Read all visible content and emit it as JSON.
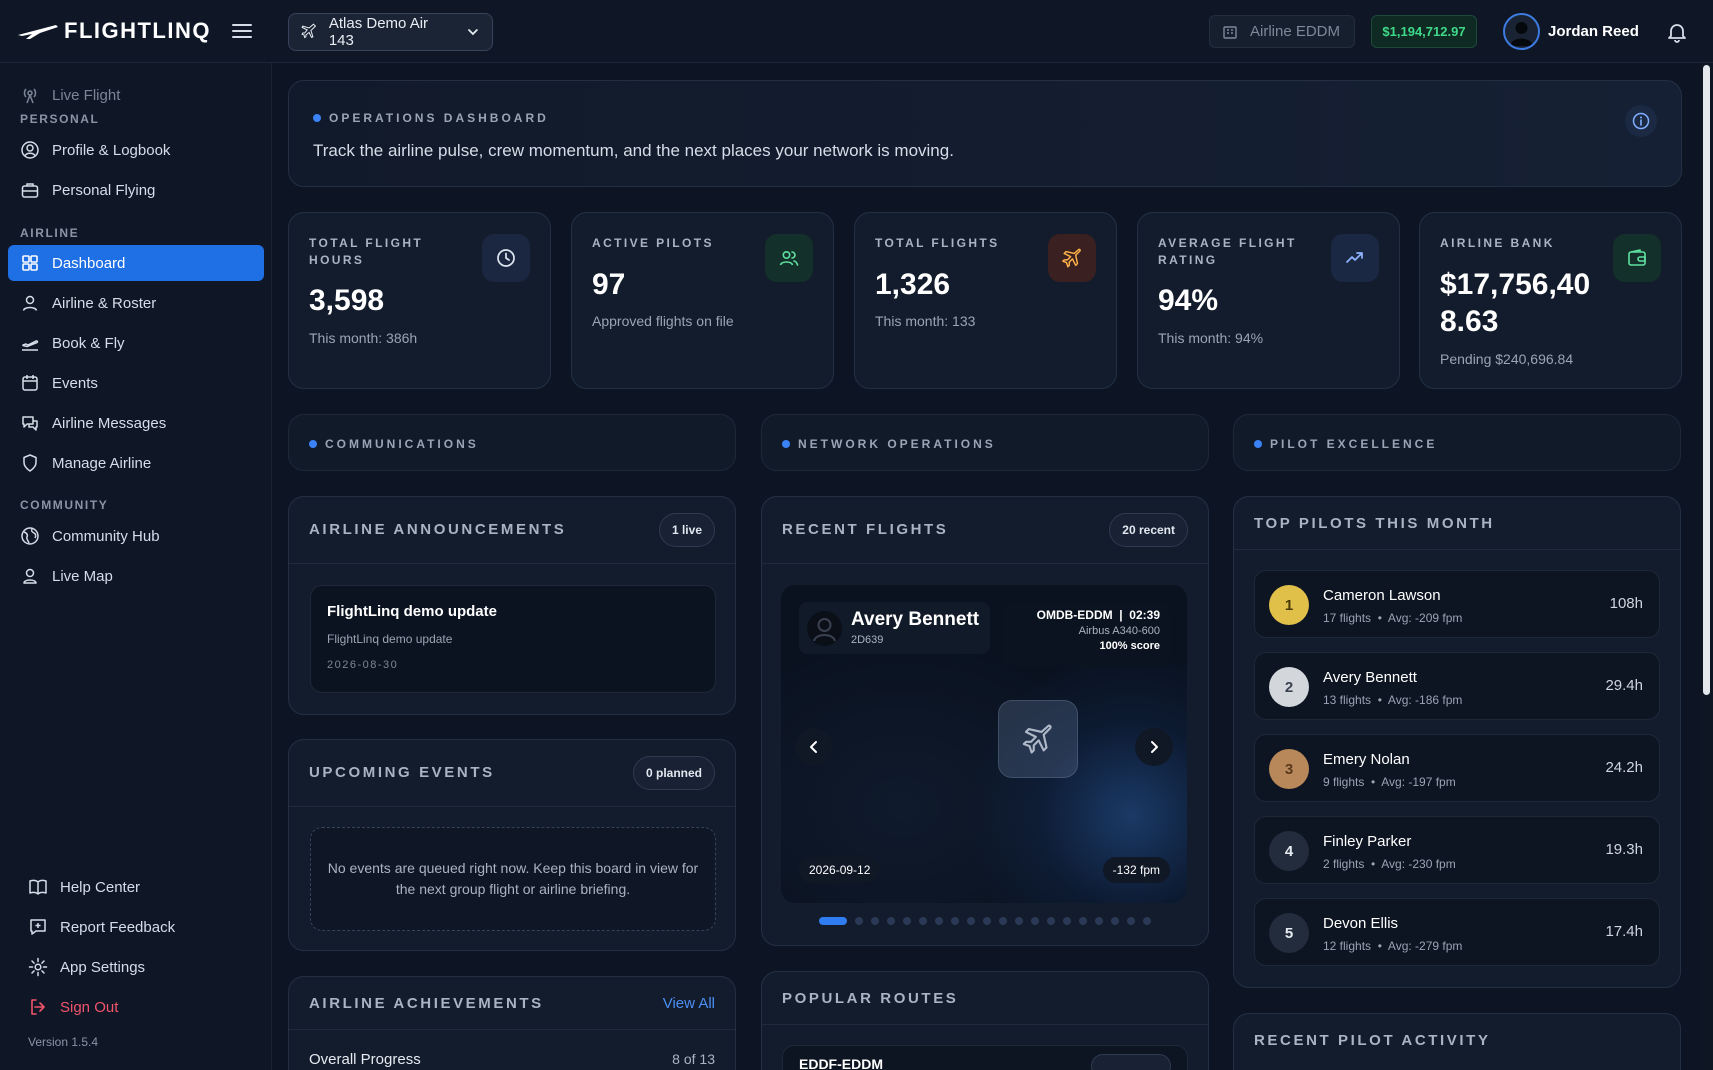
{
  "app": {
    "logo_text": "FLIGHTLINQ",
    "airline_selector": "Atlas Demo Air 143",
    "hub": "Airline EDDM",
    "balance": "$1,194,712.97",
    "user_name": "Jordan Reed"
  },
  "sidebar": {
    "live_flight": "Live Flight",
    "section_personal": "PERSONAL",
    "profile_logbook": "Profile & Logbook",
    "personal_flying": "Personal Flying",
    "section_airline": "AIRLINE",
    "dashboard": "Dashboard",
    "airline_roster": "Airline & Roster",
    "book_fly": "Book & Fly",
    "events": "Events",
    "airline_messages": "Airline Messages",
    "manage_airline": "Manage Airline",
    "section_community": "COMMUNITY",
    "community_hub": "Community Hub",
    "live_map": "Live Map",
    "help_center": "Help Center",
    "report_feedback": "Report Feedback",
    "app_settings": "App Settings",
    "sign_out": "Sign Out",
    "version": "Version 1.5.4"
  },
  "hero": {
    "kicker": "OPERATIONS DASHBOARD",
    "description": "Track the airline pulse, crew momentum, and the next places your network is moving."
  },
  "stats": [
    {
      "label": "TOTAL FLIGHT HOURS",
      "value": "3,598",
      "sub": "This month: 386h",
      "icon": "clock-icon"
    },
    {
      "label": "ACTIVE PILOTS",
      "value": "97",
      "sub": "Approved flights on file",
      "icon": "users-icon"
    },
    {
      "label": "TOTAL FLIGHTS",
      "value": "1,326",
      "sub": "This month: 133",
      "icon": "plane-icon"
    },
    {
      "label": "AVERAGE FLIGHT RATING",
      "value": "94%",
      "sub": "This month: 94%",
      "icon": "trend-up-icon"
    },
    {
      "label": "AIRLINE BANK",
      "value_line1": "$17,756,40",
      "value_line2": "8.63",
      "sub": "Pending $240,696.84",
      "icon": "wallet-icon"
    }
  ],
  "sections": {
    "communications": "COMMUNICATIONS",
    "network_operations": "NETWORK OPERATIONS",
    "pilot_excellence": "PILOT EXCELLENCE"
  },
  "announcements": {
    "title": "AIRLINE ANNOUNCEMENTS",
    "badge": "1 live",
    "item_title": "FlightLinq demo update",
    "item_body": "FlightLinq demo update",
    "item_date": "2026-08-30"
  },
  "events": {
    "title": "UPCOMING EVENTS",
    "badge": "0 planned",
    "empty_text": "No events are queued right now. Keep this board in view for the next group flight or airline briefing."
  },
  "achievements": {
    "title": "AIRLINE ACHIEVEMENTS",
    "view_all": "View All",
    "progress_label": "Overall Progress",
    "progress_value": "8 of 13"
  },
  "recent_flights": {
    "title": "RECENT FLIGHTS",
    "badge": "20 recent",
    "pilot_name": "Avery Bennett",
    "pilot_id": "2D639",
    "route": "OMDB-EDDM  |  02:39",
    "aircraft": "Airbus A340-600",
    "score": "100% score",
    "date": "2026-09-12",
    "landing_rate": "-132 fpm",
    "slide_count": 20,
    "active_slide": 1
  },
  "popular_routes": {
    "title": "POPULAR ROUTES",
    "first_route": "EDDF-EDDM"
  },
  "top_pilots": {
    "title": "TOP PILOTS THIS MONTH",
    "pilots": [
      {
        "rank": "1",
        "name": "Cameron Lawson",
        "flights": "17 flights",
        "avg": "Avg: -209 fpm",
        "hours": "108h"
      },
      {
        "rank": "2",
        "name": "Avery Bennett",
        "flights": "13 flights",
        "avg": "Avg: -186 fpm",
        "hours": "29.4h"
      },
      {
        "rank": "3",
        "name": "Emery Nolan",
        "flights": "9 flights",
        "avg": "Avg: -197 fpm",
        "hours": "24.2h"
      },
      {
        "rank": "4",
        "name": "Finley Parker",
        "flights": "2 flights",
        "avg": "Avg: -230 fpm",
        "hours": "19.3h"
      },
      {
        "rank": "5",
        "name": "Devon Ellis",
        "flights": "12 flights",
        "avg": "Avg: -279 fpm",
        "hours": "17.4h"
      }
    ]
  },
  "recent_activity": {
    "title": "RECENT PILOT ACTIVITY"
  },
  "colors": {
    "accent": "#1f6fe5",
    "background": "#0d1524",
    "panel": "#131c2c",
    "balance_green": "#3fd98a",
    "danger": "#f2546b",
    "gold": "#e1c04a",
    "silver": "#d3d7dc",
    "bronze": "#b8875a"
  }
}
